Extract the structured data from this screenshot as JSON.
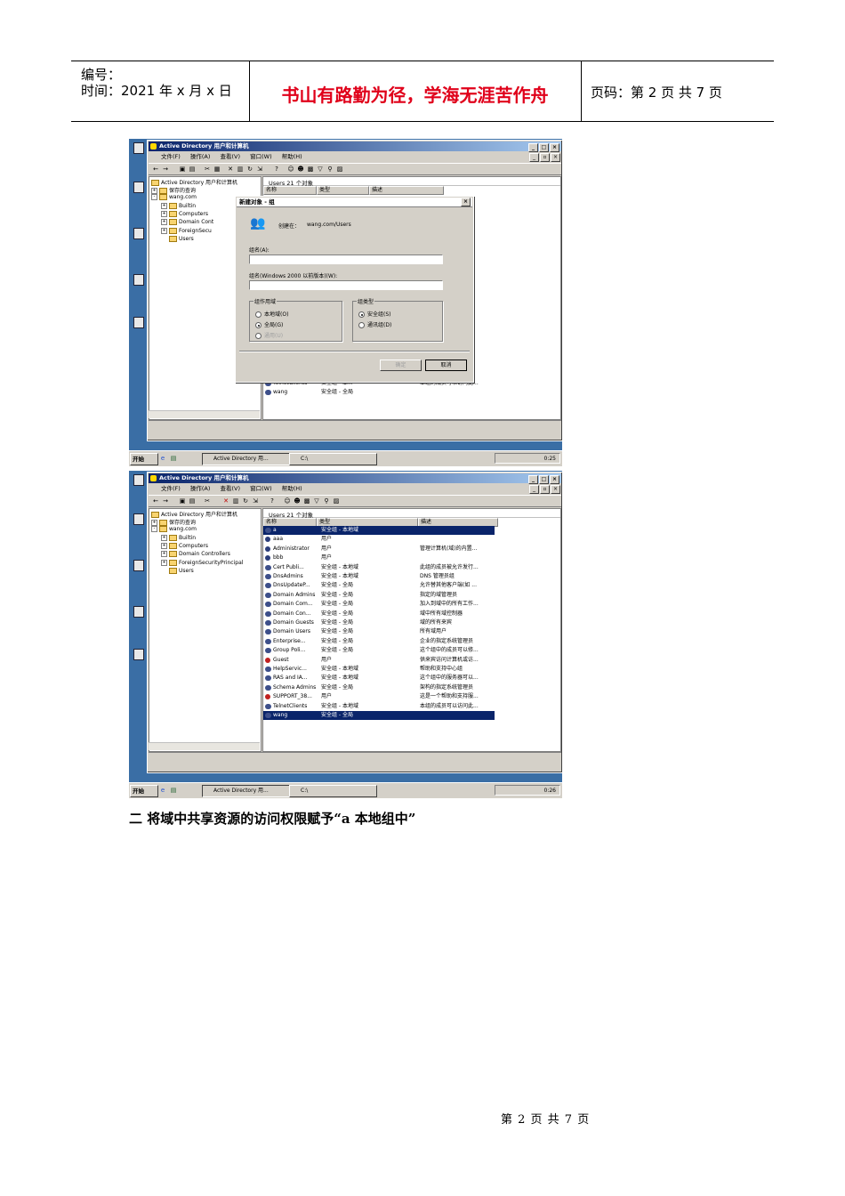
{
  "header": {
    "number_label": "编号：",
    "time_label": "时间：2021 年 x 月 x 日",
    "motto": "书山有路勤为径，学海无涯苦作舟",
    "page_label": "页码：第 2 页  共 7 页"
  },
  "screenshot1": {
    "window_title": "Active Directory 用户和计算机",
    "menu": [
      "文件(F)",
      "操作(A)",
      "查看(V)",
      "窗口(W)",
      "帮助(H)"
    ],
    "tree": {
      "root": "Active Directory 用户和计算机",
      "saved": "保存的查询",
      "domain": "wang.com",
      "children": [
        "Builtin",
        "Computers",
        "Domain Cont",
        "ForeignSecu",
        "Users"
      ]
    },
    "right_header": "Users    21 个对象",
    "columns": [
      "名称",
      "类型",
      "描述"
    ],
    "visible_rows": [
      {
        "name": "TelnetClients",
        "type": "安全组 - 本...",
        "desc": "本组的成员可以访问此..."
      },
      {
        "name": "wang",
        "type": "安全组 - 全局",
        "desc": ""
      }
    ],
    "dialog": {
      "title": "新建对象 - 组",
      "create_in_label": "创建在：",
      "create_in_value": "wang.com/Users",
      "group_name_label": "组名(A):",
      "group_name_pre2000_label": "组名(Windows 2000 以前版本)(W):",
      "scope_caption": "组作用域",
      "scope_options": [
        "本地域(O)",
        "全局(G)",
        "通用(U)"
      ],
      "type_caption": "组类型",
      "type_options": [
        "安全组(S)",
        "通讯组(D)"
      ],
      "ok": "确定",
      "cancel": "取消"
    },
    "taskbar": {
      "start": "开始",
      "task1": "Active Directory 用...",
      "task2": "C:\\",
      "clock": "0:25"
    }
  },
  "screenshot2": {
    "window_title": "Active Directory 用户和计算机",
    "menu": [
      "文件(F)",
      "操作(A)",
      "查看(V)",
      "窗口(W)",
      "帮助(H)"
    ],
    "tree": {
      "root": "Active Directory 用户和计算机",
      "saved": "保存的查询",
      "domain": "wang.com",
      "children": [
        "Builtin",
        "Computers",
        "Domain Controllers",
        "ForeignSecurityPrincipal",
        "Users"
      ]
    },
    "right_header": "Users    21 个对象",
    "columns": [
      "名称",
      "类型",
      "描述"
    ],
    "rows": [
      {
        "name": "a",
        "type": "安全组 - 本地域",
        "desc": "",
        "sel": true,
        "icon": "grp"
      },
      {
        "name": "aaa",
        "type": "用户",
        "desc": "",
        "icon": "usr"
      },
      {
        "name": "Administrator",
        "type": "用户",
        "desc": "管理计算机(域)的内置...",
        "icon": "usr"
      },
      {
        "name": "bbb",
        "type": "用户",
        "desc": "",
        "icon": "usr"
      },
      {
        "name": "Cert Publi...",
        "type": "安全组 - 本地域",
        "desc": "此组的成员被允许发行...",
        "icon": "grp"
      },
      {
        "name": "DnsAdmins",
        "type": "安全组 - 本地域",
        "desc": "DNS 管理员组",
        "icon": "grp"
      },
      {
        "name": "DnsUpdateP...",
        "type": "安全组 - 全局",
        "desc": "允许替其他客户端(如 ...",
        "icon": "grp"
      },
      {
        "name": "Domain Admins",
        "type": "安全组 - 全局",
        "desc": "指定的域管理员",
        "icon": "grp"
      },
      {
        "name": "Domain Com...",
        "type": "安全组 - 全局",
        "desc": "加入到域中的所有工作...",
        "icon": "grp"
      },
      {
        "name": "Domain Con...",
        "type": "安全组 - 全局",
        "desc": "域中所有域控制器",
        "icon": "grp"
      },
      {
        "name": "Domain Guests",
        "type": "安全组 - 全局",
        "desc": "域的所有来宾",
        "icon": "grp"
      },
      {
        "name": "Domain Users",
        "type": "安全组 - 全局",
        "desc": "所有域用户",
        "icon": "grp"
      },
      {
        "name": "Enterprise...",
        "type": "安全组 - 全局",
        "desc": "企业的指定系统管理员",
        "icon": "grp"
      },
      {
        "name": "Group Poli...",
        "type": "安全组 - 全局",
        "desc": "这个组中的成员可以修...",
        "icon": "grp"
      },
      {
        "name": "Guest",
        "type": "用户",
        "desc": "供来宾访问计算机或访...",
        "icon": "dis"
      },
      {
        "name": "HelpServic...",
        "type": "安全组 - 本地域",
        "desc": "帮助和支持中心组",
        "icon": "grp"
      },
      {
        "name": "RAS and IA...",
        "type": "安全组 - 本地域",
        "desc": "这个组中的服务器可以...",
        "icon": "grp"
      },
      {
        "name": "Schema Admins",
        "type": "安全组 - 全局",
        "desc": "架构的指定系统管理员",
        "icon": "grp"
      },
      {
        "name": "SUPPORT_38...",
        "type": "用户",
        "desc": "这是一个帮助和支持服...",
        "icon": "dis"
      },
      {
        "name": "TelnetClients",
        "type": "安全组 - 本地域",
        "desc": "本组的成员可以访问此...",
        "icon": "grp"
      },
      {
        "name": "wang",
        "type": "安全组 - 全局",
        "desc": "",
        "sel": true,
        "icon": "grp"
      }
    ],
    "taskbar": {
      "start": "开始",
      "task1": "Active Directory 用...",
      "task2": "C:\\",
      "clock": "0:26"
    }
  },
  "section_heading": "二  将域中共享资源的访问权限赋予“a 本地组中”",
  "footer": "第 2 页 共 7 页"
}
